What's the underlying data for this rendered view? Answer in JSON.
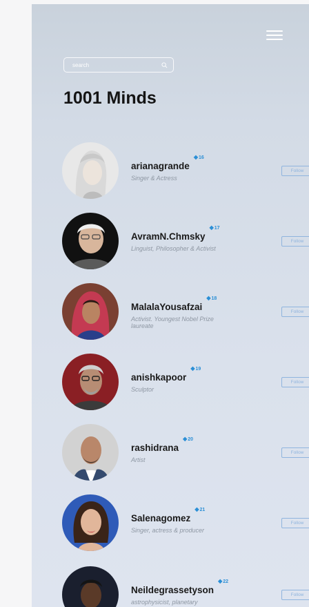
{
  "header": {
    "title": "1001 Minds",
    "search_placeholder": "search"
  },
  "follow_label": "Follow",
  "people": [
    {
      "name": "arianagrande",
      "badge": "16",
      "role": "Singer & Actress"
    },
    {
      "name": "AvramN.Chmsky",
      "badge": "17",
      "role": "Linguist, Philosopher & Activist"
    },
    {
      "name": "MalalaYousafzai",
      "badge": "18",
      "role": "Activist. Youngest Nobel Prize laureate"
    },
    {
      "name": "anishkapoor",
      "badge": "19",
      "role": "Sculptor"
    },
    {
      "name": "rashidrana",
      "badge": "20",
      "role": "Artist"
    },
    {
      "name": "Salenagomez",
      "badge": "21",
      "role": "Singer, actress & producer"
    },
    {
      "name": "Neildegrassetyson",
      "badge": "22",
      "role": "astrophysicist, planetary"
    }
  ],
  "colors": {
    "accent": "#2b8fd6",
    "follow_border": "#8fb4de",
    "title": "#141414",
    "role_text": "#8e97a3"
  }
}
